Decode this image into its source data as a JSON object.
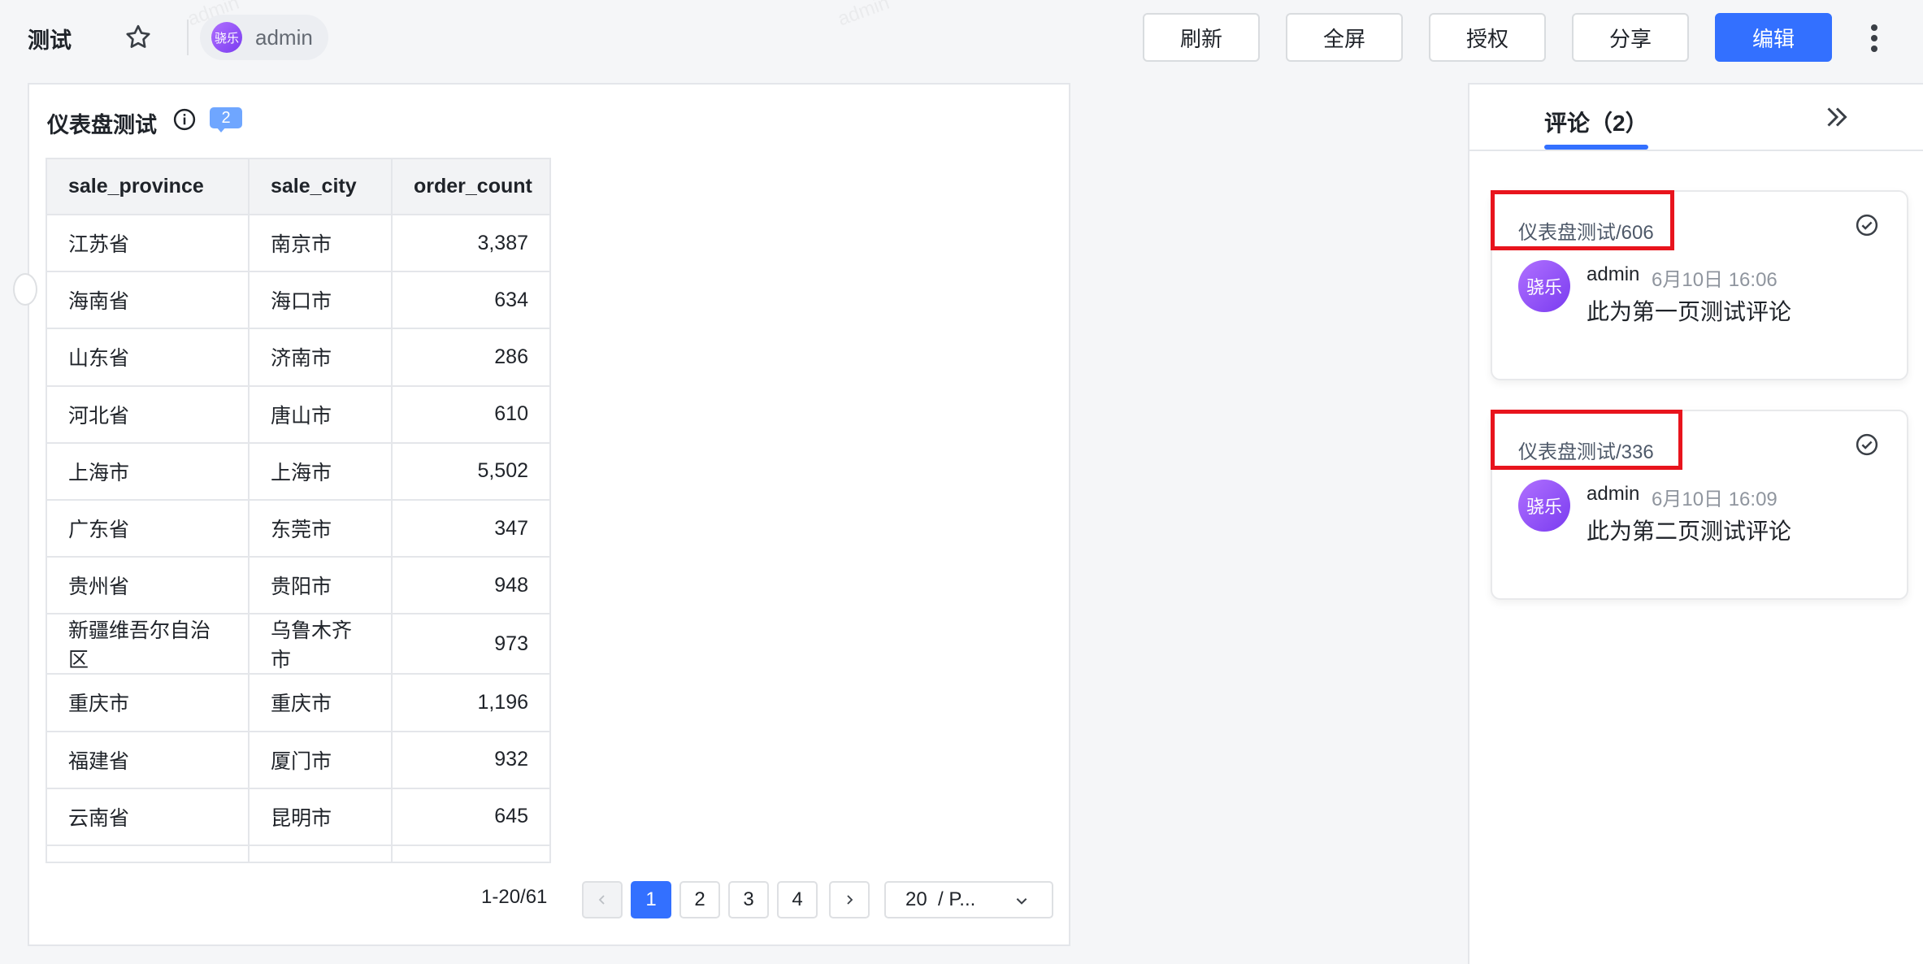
{
  "header": {
    "title": "测试",
    "owner": {
      "avatar_text": "骁乐",
      "name": "admin"
    },
    "buttons": {
      "refresh": "刷新",
      "fullscreen": "全屏",
      "authorize": "授权",
      "share": "分享",
      "edit": "编辑"
    }
  },
  "widget": {
    "title": "仪表盘测试",
    "comment_count": "2",
    "table": {
      "columns": [
        "sale_province",
        "sale_city",
        "order_count"
      ],
      "rows": [
        [
          "江苏省",
          "南京市",
          "3,387"
        ],
        [
          "海南省",
          "海口市",
          "634"
        ],
        [
          "山东省",
          "济南市",
          "286"
        ],
        [
          "河北省",
          "唐山市",
          "610"
        ],
        [
          "上海市",
          "上海市",
          "5,502"
        ],
        [
          "广东省",
          "东莞市",
          "347"
        ],
        [
          "贵州省",
          "贵阳市",
          "948"
        ],
        [
          "新疆维吾尔自治区",
          "乌鲁木齐市",
          "973"
        ],
        [
          "重庆市",
          "重庆市",
          "1,196"
        ],
        [
          "福建省",
          "厦门市",
          "932"
        ],
        [
          "云南省",
          "昆明市",
          "645"
        ]
      ]
    },
    "pagination": {
      "total": "1-20/61",
      "pages": [
        "1",
        "2",
        "3",
        "4"
      ],
      "current": "1",
      "page_size": "20  / P..."
    }
  },
  "comments_panel": {
    "tab_label": "评论（2）",
    "comments": [
      {
        "title": "仪表盘测试/606",
        "avatar_text": "骁乐",
        "user": "admin",
        "time": "6月10日 16:06",
        "text": "此为第一页测试评论"
      },
      {
        "title": "仪表盘测试/336",
        "avatar_text": "骁乐",
        "user": "admin",
        "time": "6月10日 16:09",
        "text": "此为第二页测试评论"
      }
    ]
  },
  "watermark": "admin",
  "colors": {
    "primary": "#3370ff",
    "highlight": "#e8141d",
    "avatar": "#8a4df5"
  }
}
